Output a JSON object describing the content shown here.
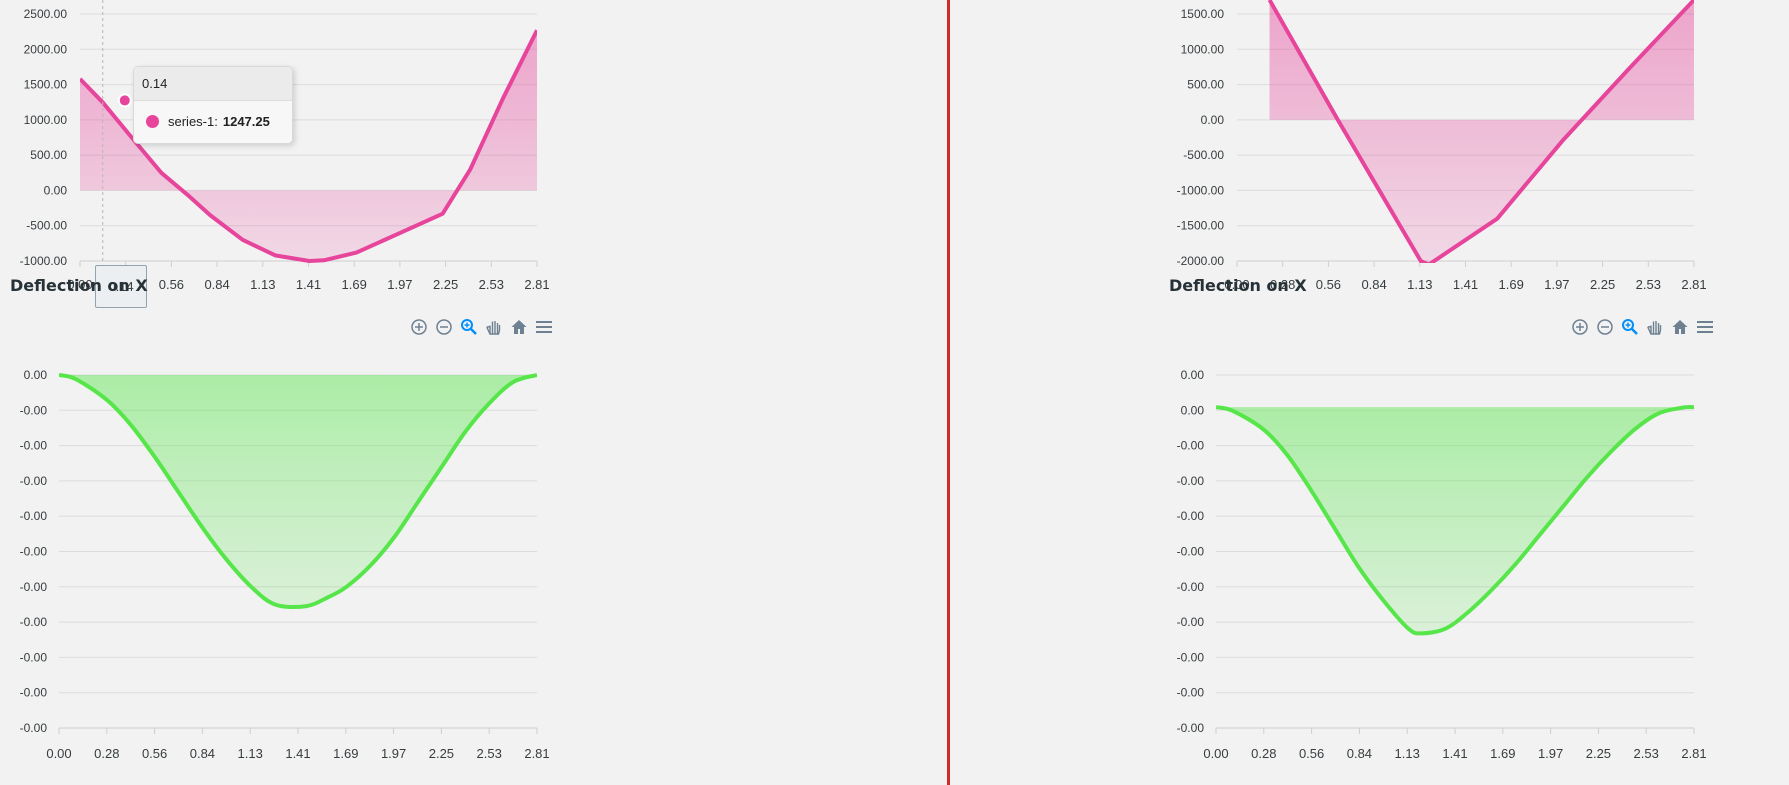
{
  "colors": {
    "moment": "#e6459b",
    "deflection": "#56e64a",
    "divider": "#d22a2a",
    "toolbar_icon": "#6e8192",
    "toolbar_active": "#008ffb"
  },
  "toolbar": {
    "icons": [
      "zoom-in-icon",
      "zoom-out-icon",
      "zoom-select-icon",
      "pan-hand-icon",
      "home-reset-icon",
      "menu-icon"
    ]
  },
  "tooltip": {
    "title": "0.14",
    "series_label": "series-1:",
    "value": "1247.25",
    "x_label": "0.14"
  },
  "chart_data": [
    {
      "type": "area",
      "position": "top-left",
      "title": "",
      "y_ticks": [
        "2500.00",
        "2000.00",
        "1500.00",
        "1000.00",
        "500.00",
        "0.00",
        "-500.00",
        "-1000.00"
      ],
      "x_ticks": [
        "0.00",
        "0.28",
        "0.56",
        "0.84",
        "1.13",
        "1.41",
        "1.69",
        "1.97",
        "2.25",
        "2.53",
        "2.81"
      ],
      "ylim": [
        -1000,
        2500
      ],
      "xlim": [
        0,
        2.81
      ],
      "series": [
        {
          "name": "series-1",
          "x": [
            0,
            0.14,
            0.3,
            0.5,
            0.66,
            0.8,
            1.0,
            1.2,
            1.41,
            1.5,
            1.7,
            1.97,
            2.23,
            2.4,
            2.6,
            2.81
          ],
          "y": [
            1580,
            1247,
            800,
            250,
            -60,
            -350,
            -700,
            -920,
            -1000,
            -990,
            -880,
            -600,
            -330,
            300,
            1300,
            2270
          ]
        }
      ],
      "hover_x": 0.14
    },
    {
      "type": "area",
      "position": "top-right",
      "title": "",
      "y_ticks": [
        "1500.00",
        "1000.00",
        "500.00",
        "0.00",
        "-500.00",
        "-1000.00",
        "-1500.00",
        "-2000.00"
      ],
      "x_ticks": [
        "0.00",
        "0.28",
        "0.56",
        "0.84",
        "1.13",
        "1.41",
        "1.69",
        "1.97",
        "2.25",
        "2.53",
        "2.81"
      ],
      "ylim": [
        -2000,
        1500
      ],
      "xlim": [
        0,
        2.81
      ],
      "series": [
        {
          "name": "series-1",
          "x": [
            0.2,
            0.62,
            1.13,
            1.18,
            1.6,
            2.0,
            2.4,
            2.81
          ],
          "y": [
            1700,
            0,
            -2000,
            -2050,
            -1400,
            -300,
            700,
            1700
          ]
        }
      ]
    },
    {
      "type": "area",
      "position": "bottom-left",
      "title": "Deflection on X",
      "y_ticks": [
        "0.00",
        "-0.00",
        "-0.00",
        "-0.00",
        "-0.00",
        "-0.00",
        "-0.00",
        "-0.00",
        "-0.00",
        "-0.00",
        "-0.00"
      ],
      "x_ticks": [
        "0.00",
        "0.28",
        "0.56",
        "0.84",
        "1.13",
        "1.41",
        "1.69",
        "1.97",
        "2.25",
        "2.53",
        "2.81"
      ],
      "ylim": [
        -1.0,
        0
      ],
      "xlim": [
        0,
        2.81
      ],
      "series": [
        {
          "name": "series-1",
          "x": [
            0,
            0.1,
            0.28,
            0.42,
            0.56,
            0.7,
            0.84,
            0.98,
            1.13,
            1.27,
            1.45,
            1.58,
            1.69,
            1.83,
            1.97,
            2.11,
            2.25,
            2.39,
            2.53,
            2.67,
            2.81
          ],
          "y": [
            0,
            -0.012,
            -0.07,
            -0.14,
            -0.23,
            -0.33,
            -0.43,
            -0.52,
            -0.6,
            -0.65,
            -0.655,
            -0.63,
            -0.6,
            -0.54,
            -0.46,
            -0.36,
            -0.26,
            -0.16,
            -0.08,
            -0.02,
            0
          ]
        }
      ]
    },
    {
      "type": "area",
      "position": "bottom-right",
      "title": "Deflection on X",
      "y_ticks": [
        "0.00",
        "0.00",
        "-0.00",
        "-0.00",
        "-0.00",
        "-0.00",
        "-0.00",
        "-0.00",
        "-0.00",
        "-0.00",
        "-0.00"
      ],
      "x_ticks": [
        "0.00",
        "0.28",
        "0.56",
        "0.84",
        "1.13",
        "1.41",
        "1.69",
        "1.97",
        "2.25",
        "2.53",
        "2.81"
      ],
      "ylim": [
        -1.0,
        0.1
      ],
      "xlim": [
        0,
        2.81
      ],
      "series": [
        {
          "name": "series-1",
          "x": [
            0,
            0.1,
            0.28,
            0.42,
            0.56,
            0.7,
            0.84,
            0.98,
            1.13,
            1.21,
            1.35,
            1.48,
            1.62,
            1.76,
            1.9,
            2.04,
            2.18,
            2.32,
            2.46,
            2.6,
            2.74,
            2.81
          ],
          "y": [
            0,
            -0.012,
            -0.07,
            -0.15,
            -0.26,
            -0.38,
            -0.5,
            -0.6,
            -0.69,
            -0.705,
            -0.69,
            -0.64,
            -0.57,
            -0.49,
            -0.4,
            -0.31,
            -0.22,
            -0.14,
            -0.07,
            -0.02,
            -0.002,
            0
          ]
        }
      ]
    }
  ]
}
